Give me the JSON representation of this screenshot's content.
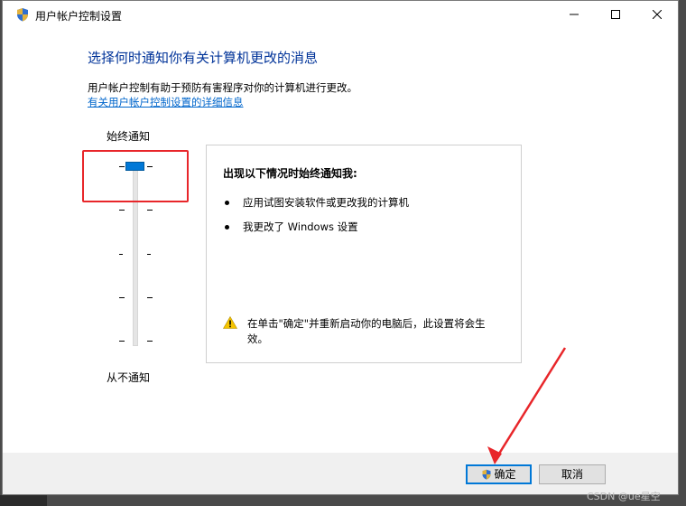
{
  "window": {
    "title": "用户帐户控制设置",
    "minimize_icon": "minimize-icon",
    "maximize_icon": "maximize-icon",
    "close_icon": "close-icon"
  },
  "header": {
    "heading": "选择何时通知你有关计算机更改的消息",
    "description": "用户帐户控制有助于预防有害程序对你的计算机进行更改。",
    "link": "有关用户帐户控制设置的详细信息"
  },
  "slider": {
    "top_label": "始终通知",
    "bottom_label": "从不通知",
    "level": 4,
    "max_level": 4
  },
  "info": {
    "title": "出现以下情况时始终通知我:",
    "bullets": [
      "应用试图安装软件或更改我的计算机",
      "我更改了 Windows 设置"
    ],
    "warning": "在单击\"确定\"并重新启动你的电脑后，此设置将会生效。"
  },
  "buttons": {
    "ok": "确定",
    "cancel": "取消"
  },
  "watermark": "CSDN @ue星空",
  "colors": {
    "heading": "#003399",
    "link": "#0066cc",
    "slider_thumb": "#0078d7",
    "annotation": "#e8262a"
  }
}
